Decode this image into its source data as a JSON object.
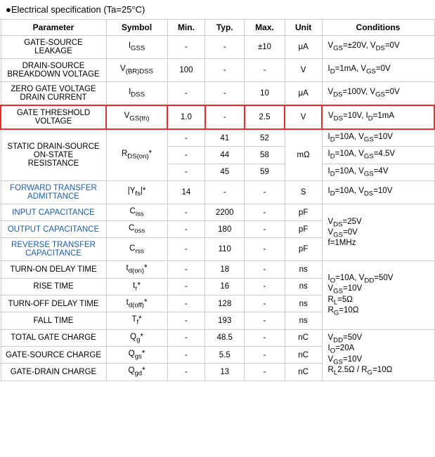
{
  "header": {
    "title": "●Electrical specification (Ta=25°C)"
  },
  "table": {
    "columns": [
      "Parameter",
      "Symbol",
      "Min.",
      "Typ.",
      "Max.",
      "Unit",
      "Conditions"
    ],
    "rows": [
      {
        "param": "GATE-SOURCE LEAKAGE",
        "symbol": "IGSS",
        "min": "-",
        "typ": "-",
        "max": "±10",
        "unit": "μA",
        "conditions": "VGS=±20V, VDS=0V",
        "highlight": false,
        "blue_param": false,
        "blue_symbol": false,
        "rowspan": 1
      },
      {
        "param": "DRAIN-SOURCE BREAKDOWN VOLTAGE",
        "symbol": "V(BR)DSS",
        "min": "100",
        "typ": "-",
        "max": "-",
        "unit": "V",
        "conditions": "ID=1mA, VGS=0V",
        "highlight": false,
        "blue_param": false,
        "blue_symbol": false,
        "rowspan": 1
      },
      {
        "param": "ZERO GATE VOLTAGE DRAIN CURRENT",
        "symbol": "IDSS",
        "min": "-",
        "typ": "-",
        "max": "10",
        "unit": "μA",
        "conditions": "VDS=100V, VGS=0V",
        "highlight": false,
        "blue_param": false,
        "blue_symbol": false,
        "rowspan": 1
      },
      {
        "param": "GATE THRESHOLD VOLTAGE",
        "symbol": "VGS(th)",
        "min": "1.0",
        "typ": "-",
        "max": "2.5",
        "unit": "V",
        "conditions": "VDS=10V, ID=1mA",
        "highlight": true,
        "blue_param": false,
        "blue_symbol": false,
        "rowspan": 1
      },
      {
        "param": "STATIC DRAIN-SOURCE ON-STATE RESISTANCE",
        "symbol": "RDS(on)*",
        "min": "-",
        "typ_rows": [
          "41",
          "44",
          "45"
        ],
        "max_rows": [
          "52",
          "58",
          "59"
        ],
        "unit": "mΩ",
        "conditions_rows": [
          "ID=10A, VGS=10V",
          "ID=10A, VGS=4.5V",
          "ID=10A, VGS=4V"
        ],
        "highlight": false,
        "blue_param": false,
        "blue_symbol": false,
        "multi": true
      },
      {
        "param": "FORWARD TRANSFER ADMITTANCE",
        "symbol": "|Yfs|*",
        "min": "14",
        "typ": "-",
        "max": "-",
        "unit": "S",
        "conditions": "ID=10A, VDS=10V",
        "highlight": false,
        "blue_param": true,
        "blue_symbol": true,
        "rowspan": 1
      },
      {
        "param": "INPUT CAPACITANCE",
        "symbol": "Ciss",
        "min": "-",
        "typ": "2200",
        "max": "-",
        "unit": "pF",
        "conditions": "",
        "highlight": false,
        "blue_param": true,
        "blue_symbol": false,
        "rowspan": 1,
        "conditions_rowspan": 3
      },
      {
        "param": "OUTPUT CAPACITANCE",
        "symbol": "Coss",
        "min": "-",
        "typ": "180",
        "max": "-",
        "unit": "pF",
        "conditions": "",
        "highlight": false,
        "blue_param": true,
        "blue_symbol": false,
        "rowspan": 1,
        "skip_conditions": true
      },
      {
        "param": "REVERSE TRANSFER CAPACITANCE",
        "symbol": "Crss",
        "min": "-",
        "typ": "110",
        "max": "-",
        "unit": "pF",
        "conditions": "",
        "highlight": false,
        "blue_param": true,
        "blue_symbol": false,
        "rowspan": 1,
        "skip_conditions": true
      },
      {
        "param": "TURN-ON DELAY TIME",
        "symbol": "td(on)*",
        "min": "-",
        "typ": "18",
        "max": "-",
        "unit": "ns",
        "conditions": "",
        "highlight": false,
        "blue_param": false,
        "blue_symbol": false,
        "rowspan": 1,
        "conditions_rowspan": 4
      },
      {
        "param": "RISE TIME",
        "symbol": "tr*",
        "min": "-",
        "typ": "16",
        "max": "-",
        "unit": "ns",
        "conditions": "",
        "highlight": false,
        "blue_param": false,
        "blue_symbol": false,
        "rowspan": 1,
        "skip_conditions": true
      },
      {
        "param": "TURN-OFF DELAY TIME",
        "symbol": "td(off)*",
        "min": "-",
        "typ": "128",
        "max": "-",
        "unit": "ns",
        "conditions": "",
        "highlight": false,
        "blue_param": false,
        "blue_symbol": false,
        "rowspan": 1,
        "skip_conditions": true
      },
      {
        "param": "FALL TIME",
        "symbol": "Tf*",
        "min": "-",
        "typ": "193",
        "max": "-",
        "unit": "ns",
        "conditions": "",
        "highlight": false,
        "blue_param": false,
        "blue_symbol": false,
        "rowspan": 1,
        "skip_conditions": true
      },
      {
        "param": "TOTAL GATE CHARGE",
        "symbol": "Qg*",
        "min": "-",
        "typ": "48.5",
        "max": "-",
        "unit": "nC",
        "conditions": "",
        "highlight": false,
        "blue_param": false,
        "blue_symbol": false,
        "rowspan": 1,
        "conditions_rowspan": 3
      },
      {
        "param": "GATE-SOURCE CHARGE",
        "symbol": "Qgs*",
        "min": "-",
        "typ": "5.5",
        "max": "-",
        "unit": "nC",
        "conditions": "",
        "highlight": false,
        "blue_param": false,
        "blue_symbol": false,
        "rowspan": 1,
        "skip_conditions": true
      },
      {
        "param": "GATE-DRAIN CHARGE",
        "symbol": "Qgd*",
        "min": "-",
        "typ": "13",
        "max": "-",
        "unit": "nC",
        "conditions": "",
        "highlight": false,
        "blue_param": false,
        "blue_symbol": false,
        "rowspan": 1,
        "skip_conditions": true
      }
    ],
    "conditions_groups": {
      "capacitance": "VDS=25V\nVGS=0V\nf=1MHz",
      "switching": "IO=10A, VDD=50V\nVGS=10V\nRL=5Ω\nRG=10Ω",
      "charge": "VDD=50V\nIO=20A\nVGS=10V\nRL2.5Ω / RG=10Ω"
    }
  }
}
